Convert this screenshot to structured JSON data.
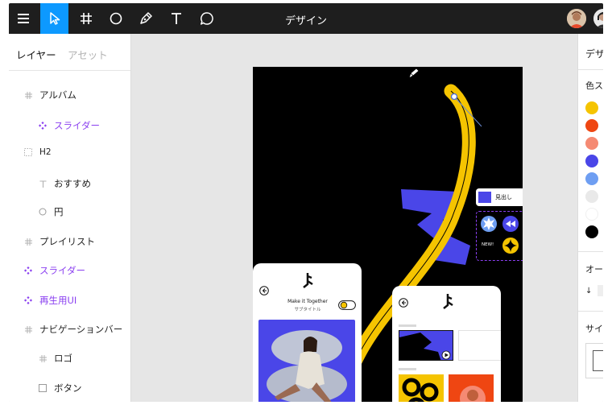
{
  "toolbar": {
    "title": "デザイン",
    "tools": [
      "menu-icon",
      "move-icon",
      "frame-icon",
      "ellipse-icon",
      "pen-icon",
      "text-icon",
      "comment-icon"
    ]
  },
  "layers_panel": {
    "tab_layers": "レイヤー",
    "tab_assets": "アセット",
    "items": [
      {
        "label": "アルバム",
        "icon": "frame-icon"
      },
      {
        "label": "スライダー",
        "icon": "component-icon"
      },
      {
        "label": "H2",
        "icon": "dotted-frame-icon"
      },
      {
        "label": "おすすめ",
        "icon": "text-icon"
      },
      {
        "label": "円",
        "icon": "ellipse-icon"
      },
      {
        "label": "プレイリスト",
        "icon": "frame-icon"
      },
      {
        "label": "スライダー",
        "icon": "component-icon"
      },
      {
        "label": "再生用UI",
        "icon": "component-icon"
      },
      {
        "label": "ナビゲーションバー",
        "icon": "frame-icon"
      },
      {
        "label": "ロゴ",
        "icon": "frame-icon"
      },
      {
        "label": "ボタン",
        "icon": "rectangle-icon"
      }
    ]
  },
  "canvas": {
    "heading_label": "見出し",
    "new_badge": "NEW!",
    "card_title": "Make it Together",
    "card_subtitle": "サブタイトル"
  },
  "right_panel": {
    "design_tab": "デザ",
    "color_label": "色ス",
    "swatches": [
      "#f5c400",
      "#ef4612",
      "#f58a73",
      "#4a46e8",
      "#6e9ef2",
      "#e9e9e9",
      "#ffffff",
      "#000000"
    ],
    "overflow_label": "オー",
    "arrow": "↓",
    "size_label": "サイ"
  },
  "colors": {
    "accent": "#0d99ff",
    "component": "#8a3ff0",
    "yellow": "#f5c400",
    "blue": "#4a46e8"
  }
}
